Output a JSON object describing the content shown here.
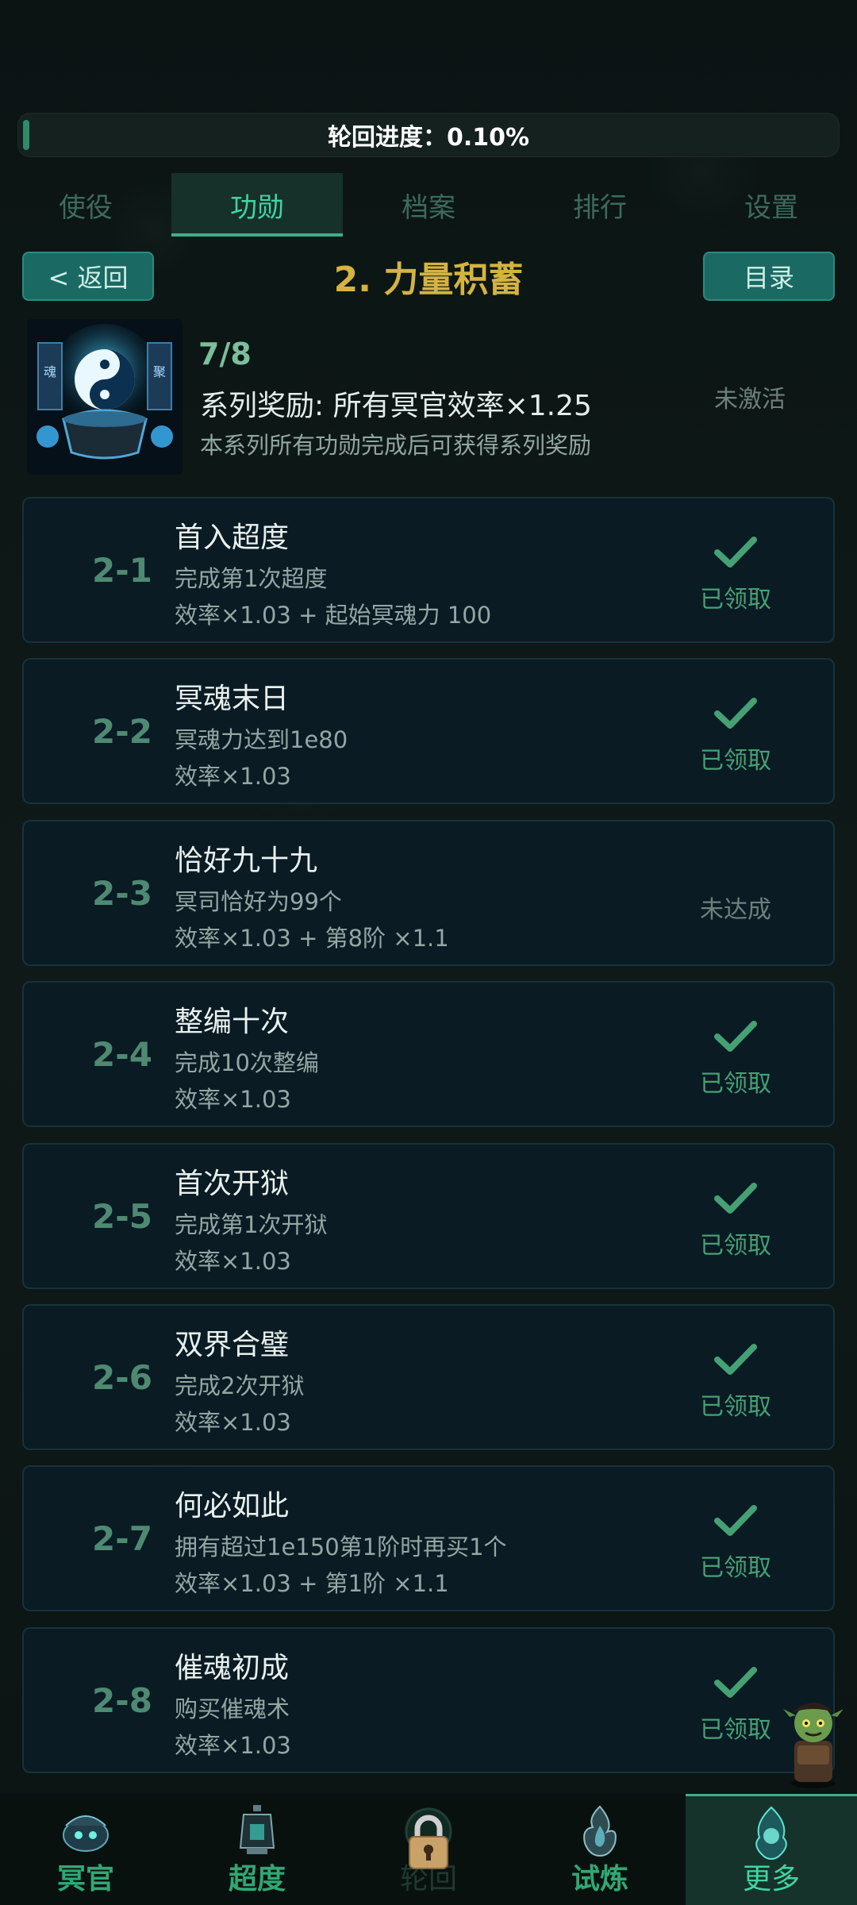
{
  "progress": {
    "label": "轮回进度：0.10%",
    "value_percent": 0.1
  },
  "tabs": [
    {
      "label": "使役",
      "active": false
    },
    {
      "label": "功勋",
      "active": true
    },
    {
      "label": "档案",
      "active": false
    },
    {
      "label": "排行",
      "active": false
    },
    {
      "label": "设置",
      "active": false
    }
  ],
  "header": {
    "back_label": "< 返回",
    "title": "2. 力量积蓄",
    "menu_label": "目录"
  },
  "series": {
    "image_icon": "yin-yang-cauldron-icon",
    "count": "7/8",
    "reward": "系列奖励: 所有冥官效率×1.25",
    "description": "本系列所有功勋完成后可获得系列奖励",
    "status": "未激活"
  },
  "achievements": [
    {
      "id": "2-1",
      "title": "首入超度",
      "description": "完成第1次超度",
      "reward": "效率×1.03 + 起始冥魂力 100",
      "status": "已领取",
      "claimed": true
    },
    {
      "id": "2-2",
      "title": "冥魂末日",
      "description": "冥魂力达到1e80",
      "reward": "效率×1.03",
      "status": "已领取",
      "claimed": true
    },
    {
      "id": "2-3",
      "title": "恰好九十九",
      "description": "冥司恰好为99个",
      "reward": "效率×1.03 + 第8阶 ×1.1",
      "status": "未达成",
      "claimed": false
    },
    {
      "id": "2-4",
      "title": "整编十次",
      "description": "完成10次整编",
      "reward": "效率×1.03",
      "status": "已领取",
      "claimed": true
    },
    {
      "id": "2-5",
      "title": "首次开狱",
      "description": "完成第1次开狱",
      "reward": "效率×1.03",
      "status": "已领取",
      "claimed": true
    },
    {
      "id": "2-6",
      "title": "双界合璧",
      "description": "完成2次开狱",
      "reward": "效率×1.03",
      "status": "已领取",
      "claimed": true
    },
    {
      "id": "2-7",
      "title": "何必如此",
      "description": "拥有超过1e150第1阶时再买1个",
      "reward": "效率×1.03 + 第1阶 ×1.1",
      "status": "已领取",
      "claimed": true
    },
    {
      "id": "2-8",
      "title": "催魂初成",
      "description": "购买催魂术",
      "reward": "效率×1.03",
      "status": "已领取",
      "claimed": true
    }
  ],
  "bottom_nav": [
    {
      "label": "冥官",
      "icon": "ghost-official-icon",
      "state": "normal"
    },
    {
      "label": "超度",
      "icon": "lantern-icon",
      "state": "normal"
    },
    {
      "label": "轮回",
      "icon": "lock-icon",
      "state": "locked"
    },
    {
      "label": "试炼",
      "icon": "flame-icon",
      "state": "normal"
    },
    {
      "label": "更多",
      "icon": "spirit-flame-icon",
      "state": "active"
    }
  ],
  "colors": {
    "accent": "#3fd6a0",
    "title_gold": "#d4b342",
    "claimed_green": "#45a173",
    "card_bg": "#0a1b24"
  }
}
